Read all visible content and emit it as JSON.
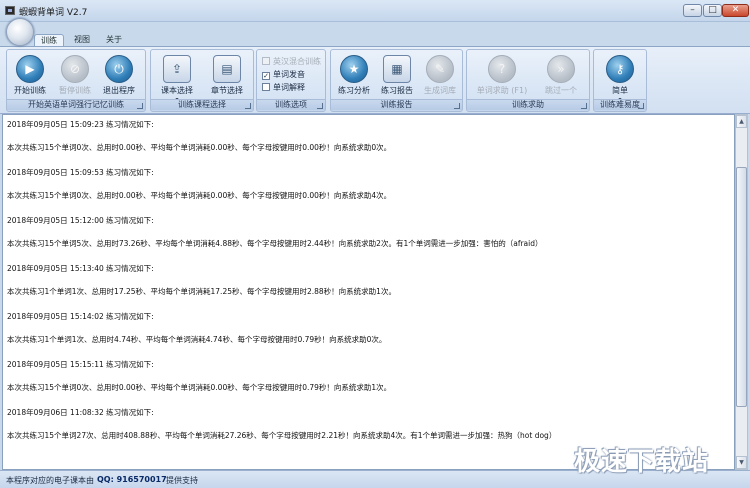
{
  "window": {
    "title": "蝦蝦背单词 V2.7",
    "controls": {
      "minimize": "–",
      "maximize": "□",
      "close": "✕"
    }
  },
  "tabs": [
    {
      "label": "训练",
      "active": true
    },
    {
      "label": "视图",
      "active": false
    },
    {
      "label": "关于",
      "active": false
    }
  ],
  "ribbon": {
    "groups": {
      "start": {
        "label": "开始英语单词强行记忆训练",
        "buttons": [
          {
            "label": "开始训练",
            "icon": "play-icon",
            "enabled": true
          },
          {
            "label": "暂停训练",
            "icon": "pause-icon",
            "enabled": false
          },
          {
            "label": "退出程序",
            "icon": "power-icon",
            "enabled": true
          }
        ]
      },
      "course": {
        "label": "训练课程选择",
        "buttons": [
          {
            "label": "课本选择",
            "icon": "textbook-icon",
            "enabled": true,
            "dropdown": true
          },
          {
            "label": "章节选择",
            "icon": "chapter-icon",
            "enabled": true
          }
        ]
      },
      "options": {
        "label": "训练选项",
        "items": [
          {
            "label": "英汉混合训练",
            "checked": false,
            "enabled": false
          },
          {
            "label": "单词发音",
            "checked": true,
            "enabled": true
          },
          {
            "label": "单词解释",
            "checked": false,
            "enabled": true
          }
        ]
      },
      "report": {
        "label": "训练报告",
        "buttons": [
          {
            "label": "练习分析",
            "icon": "star-icon",
            "enabled": true
          },
          {
            "label": "练习报告",
            "icon": "report-icon",
            "enabled": true
          },
          {
            "label": "生成词库",
            "icon": "generate-icon",
            "enabled": false
          }
        ]
      },
      "help": {
        "label": "训练求助",
        "buttons": [
          {
            "label": "单词求助 (F1)",
            "icon": "help-icon",
            "enabled": false
          },
          {
            "label": "跳过一个",
            "icon": "skip-icon",
            "enabled": false
          }
        ]
      },
      "difficulty": {
        "label": "训练难易度",
        "buttons": [
          {
            "label": "简单",
            "icon": "key-icon",
            "enabled": true,
            "dropdown": true
          }
        ]
      }
    }
  },
  "log": [
    {
      "timestamp": "2018年09月05日 15:09:23 练习情况如下:",
      "message": "本次共练习15个单词0次、总用时0.00秒、平均每个单词消耗0.00秒、每个字母按键用时0.00秒！向系统求助0次。"
    },
    {
      "timestamp": "2018年09月05日 15:09:53 练习情况如下:",
      "message": "本次共练习15个单词0次、总用时0.00秒、平均每个单词消耗0.00秒、每个字母按键用时0.00秒！向系统求助4次。"
    },
    {
      "timestamp": "2018年09月05日 15:12:00 练习情况如下:",
      "message": "本次共练习15个单词5次、总用时73.26秒、平均每个单词消耗4.88秒、每个字母按键用时2.44秒！向系统求助2次。有1个单词需进一步加强：害怕的（afraid）"
    },
    {
      "timestamp": "2018年09月05日 15:13:40 练习情况如下:",
      "message": "本次共练习1个单词1次、总用时17.25秒、平均每个单词消耗17.25秒、每个字母按键用时2.88秒！向系统求助1次。"
    },
    {
      "timestamp": "2018年09月05日 15:14:02 练习情况如下:",
      "message": "本次共练习1个单词1次、总用时4.74秒、平均每个单词消耗4.74秒、每个字母按键用时0.79秒！向系统求助0次。"
    },
    {
      "timestamp": "2018年09月05日 15:15:11 练习情况如下:",
      "message": "本次共练习15个单词0次、总用时0.00秒、平均每个单词消耗0.00秒、每个字母按键用时0.79秒！向系统求助1次。"
    },
    {
      "timestamp": "2018年09月06日 11:08:32 练习情况如下:",
      "message": "本次共练习15个单词27次、总用时408.88秒、平均每个单词消耗27.26秒、每个字母按键用时2.21秒！向系统求助4次。有1个单词需进一步加强：热狗（hot dog）"
    }
  ],
  "status": {
    "text1": "本程序对应的电子课本由",
    "qq": "QQ: 916570017",
    "text2": "提供支持"
  },
  "watermark": "极速下载站"
}
